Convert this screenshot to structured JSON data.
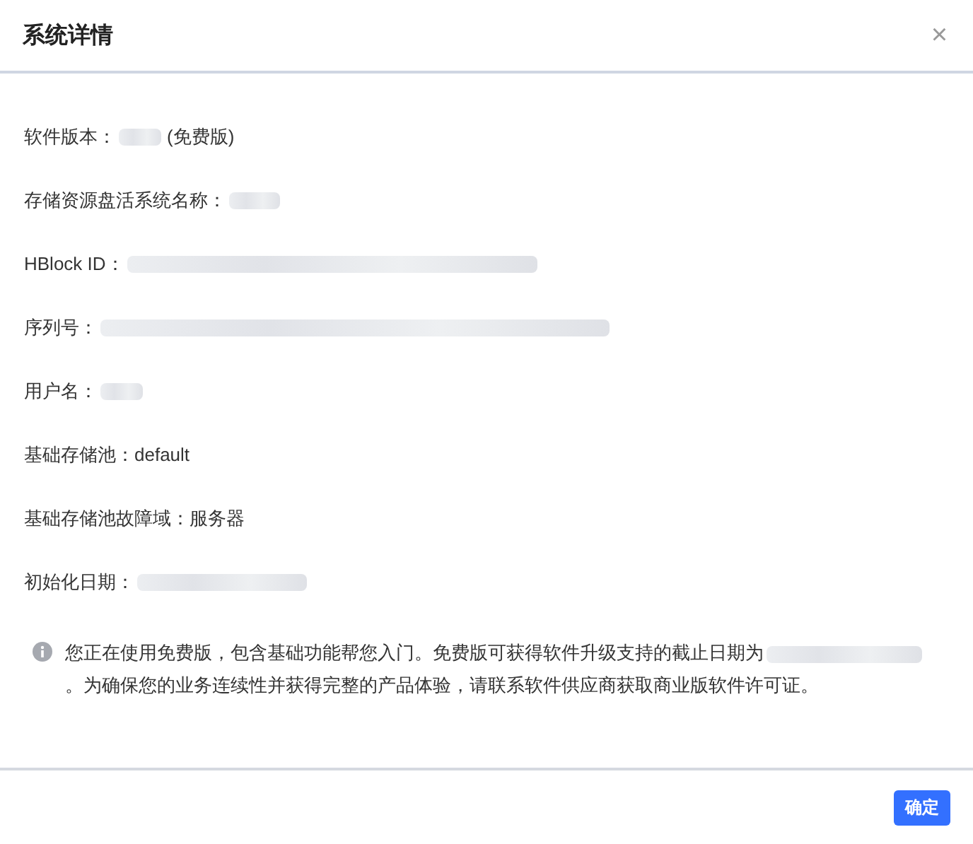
{
  "dialog": {
    "title": "系统详情",
    "close": "×"
  },
  "fields": [
    {
      "label": "软件版本：",
      "value_redacted": true,
      "value": "(免费版)"
    },
    {
      "label": "存储资源盘活系统名称：",
      "value_redacted": true
    },
    {
      "label": "HBlock ID：",
      "value_redacted": true
    },
    {
      "label": "序列号：",
      "value_redacted": true
    },
    {
      "label": "用户名：",
      "value_redacted": true
    },
    {
      "label": "基础存储池：",
      "value_redacted": false,
      "value": "default"
    },
    {
      "label": "基础存储池故障域：",
      "value_redacted": false,
      "value": "服务器"
    },
    {
      "label": "初始化日期：",
      "value_redacted": true
    }
  ],
  "notice": {
    "before": "您正在使用免费版，包含基础功能帮您入门。免费版可获得软件升级支持的截止日期为",
    "date_redacted": true,
    "after": "。为确保您的业务连续性并获得完整的产品体验，请联系软件供应商获取商业版软件许可证。"
  },
  "buttons": [
    "确定"
  ]
}
